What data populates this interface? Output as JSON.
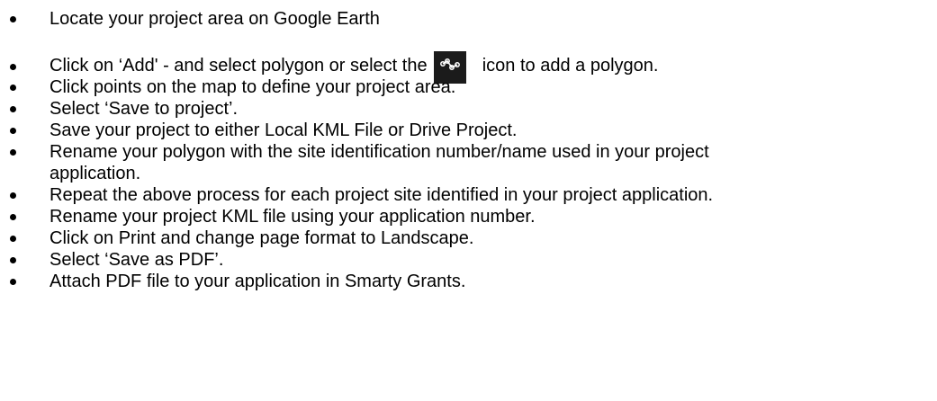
{
  "steps": [
    {
      "text": "Locate your project area on Google Earth"
    },
    {
      "before": "Click on ‘Add' - and select polygon or select the",
      "icon": "polygon-path-icon",
      "after": "icon to add a polygon."
    },
    {
      "text": "Click points on the map to define your project area."
    },
    {
      "text": "Select ‘Save to project’."
    },
    {
      "text": "Save your project to either Local KML File or Drive Project."
    },
    {
      "line1": "Rename your polygon with the site identification number/name used in your project",
      "line2": "application."
    },
    {
      "text": "Repeat the above process for each project site identified in your project application."
    },
    {
      "text": "Rename your project KML file using your application number."
    },
    {
      "text": "Click on Print and change page format to Landscape."
    },
    {
      "text": "Select ‘Save as PDF’."
    },
    {
      "text": "Attach PDF file to your application in Smarty Grants."
    }
  ],
  "colors": {
    "text": "#000000",
    "icon_bg": "#1b1b1b",
    "icon_fg": "#ffffff"
  }
}
